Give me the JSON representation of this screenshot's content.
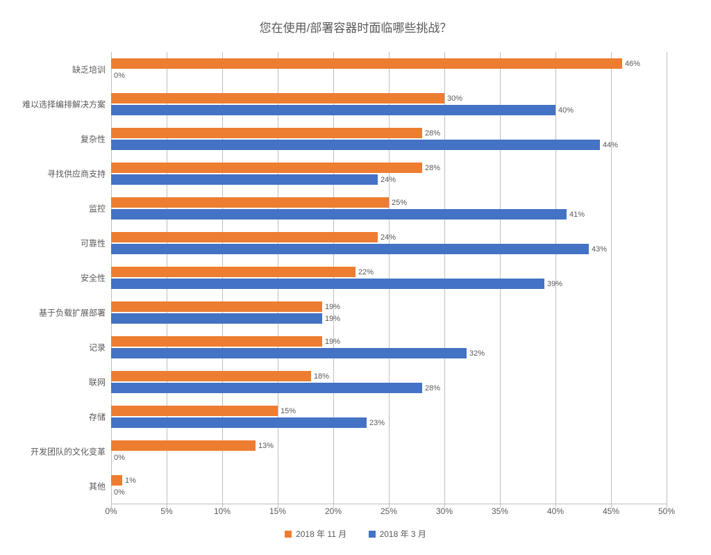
{
  "chart_data": {
    "type": "bar",
    "orientation": "horizontal",
    "title": "您在使用/部署容器时面临哪些挑战？",
    "xlabel": "",
    "ylabel": "",
    "xlim": [
      0,
      50
    ],
    "x_ticks": [
      0,
      5,
      10,
      15,
      20,
      25,
      30,
      35,
      40,
      45,
      50
    ],
    "x_tick_labels": [
      "0%",
      "5%",
      "10%",
      "15%",
      "20%",
      "25%",
      "30%",
      "35%",
      "40%",
      "45%",
      "50%"
    ],
    "categories": [
      "缺乏培训",
      "难以选择编排解决方案",
      "复杂性",
      "寻找供应商支持",
      "监控",
      "可靠性",
      "安全性",
      "基于负载扩展部署",
      "记录",
      "联网",
      "存储",
      "开发团队的文化变革",
      "其他"
    ],
    "series": [
      {
        "name": "2018 年 11 月",
        "values": [
          46,
          30,
          28,
          28,
          25,
          24,
          22,
          19,
          19,
          18,
          15,
          13,
          1
        ]
      },
      {
        "name": "2018 年 3 月",
        "values": [
          0,
          40,
          44,
          24,
          41,
          43,
          39,
          19,
          32,
          28,
          23,
          0,
          0
        ]
      }
    ],
    "data_label_suffix": "%",
    "colors": {
      "series_a": "#ed7d31",
      "series_b": "#4472c4"
    }
  }
}
